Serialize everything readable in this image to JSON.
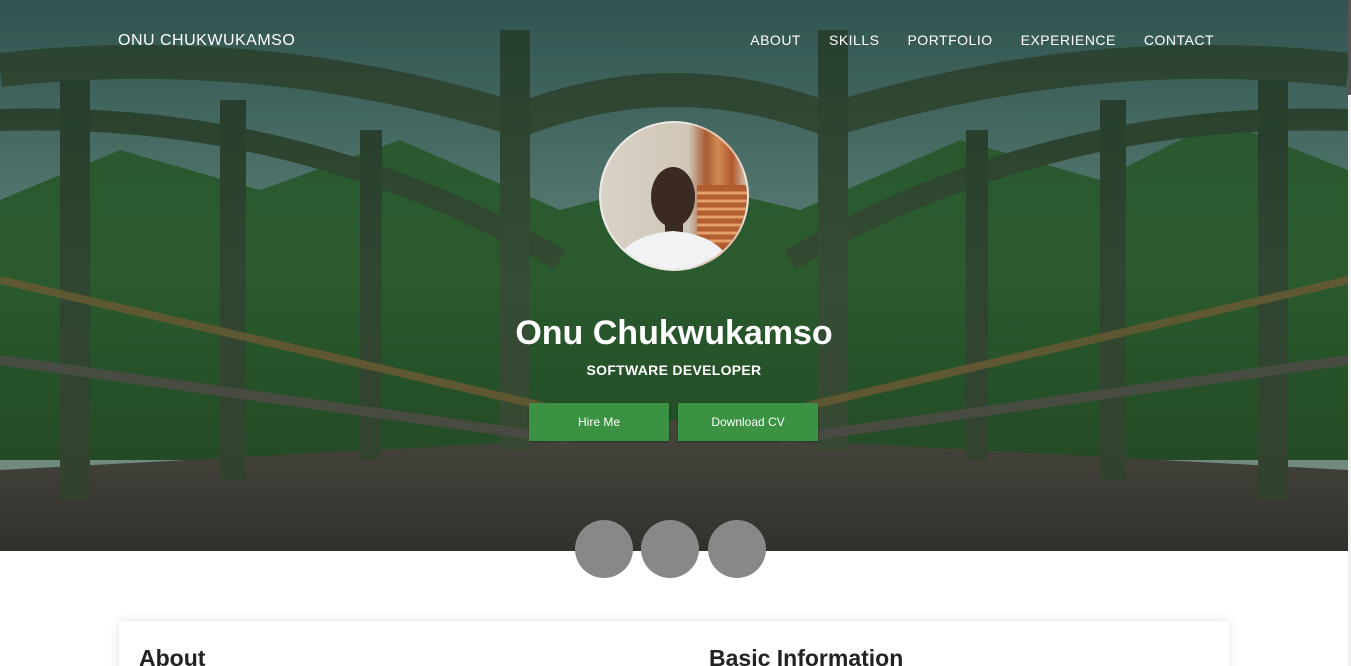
{
  "brand": "ONU CHUKWUKAMSO",
  "nav": {
    "about": "ABOUT",
    "skills": "SKILLS",
    "portfolio": "PORTFOLIO",
    "experience": "EXPERIENCE",
    "contact": "CONTACT"
  },
  "hero": {
    "name": "Onu Chukwukamso",
    "role": "SOFTWARE DEVELOPER",
    "hire_label": "Hire Me",
    "cv_label": "Download CV"
  },
  "sections": {
    "about_title": "About",
    "basic_title": "Basic Information"
  },
  "colors": {
    "accent": "#3a9242",
    "social_placeholder": "#888888"
  },
  "icons": {
    "social": [
      "social-icon-placeholder",
      "social-icon-placeholder",
      "social-icon-placeholder"
    ]
  }
}
